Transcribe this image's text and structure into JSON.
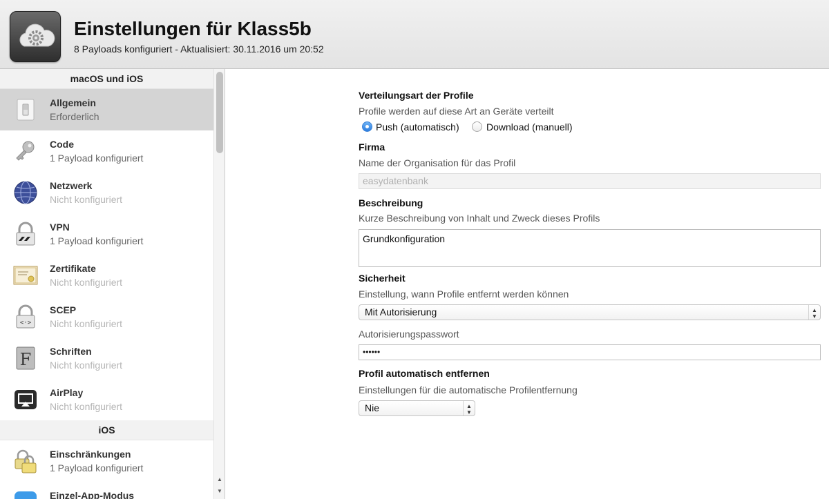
{
  "header": {
    "title": "Einstellungen für Klass5b",
    "subtitle": "8 Payloads konfiguriert - Aktualisiert: 30.11.2016 um 20:52",
    "icon": "cloud-gear-icon"
  },
  "sidebar": {
    "sections": [
      {
        "title": "macOS und iOS",
        "items": [
          {
            "title": "Allgemein",
            "subtitle": "Erforderlich",
            "icon": "switch-icon",
            "selected": true,
            "configured": true
          },
          {
            "title": "Code",
            "subtitle": "1 Payload konfiguriert",
            "icon": "key-icon",
            "configured": true
          },
          {
            "title": "Netzwerk",
            "subtitle": "Nicht konfiguriert",
            "icon": "globe-icon",
            "configured": false
          },
          {
            "title": "VPN",
            "subtitle": "1 Payload konfiguriert",
            "icon": "vpn-lock-icon",
            "configured": true
          },
          {
            "title": "Zertifikate",
            "subtitle": "Nicht konfiguriert",
            "icon": "certificate-icon",
            "configured": false
          },
          {
            "title": "SCEP",
            "subtitle": "Nicht konfiguriert",
            "icon": "scep-lock-icon",
            "configured": false
          },
          {
            "title": "Schriften",
            "subtitle": "Nicht konfiguriert",
            "icon": "font-icon",
            "configured": false
          },
          {
            "title": "AirPlay",
            "subtitle": "Nicht konfiguriert",
            "icon": "airplay-icon",
            "configured": false
          }
        ]
      },
      {
        "title": "iOS",
        "items": [
          {
            "title": "Einschränkungen",
            "subtitle": "1 Payload konfiguriert",
            "icon": "restrictions-lock-icon",
            "configured": true
          },
          {
            "title": "Einzel-App-Modus",
            "subtitle": "",
            "icon": "app-store-icon",
            "configured": false
          }
        ]
      }
    ]
  },
  "form": {
    "distribution": {
      "label": "Verteilungsart der Profile",
      "description": "Profile werden auf diese Art an Geräte verteilt",
      "options": [
        {
          "label": "Push (automatisch)",
          "selected": true
        },
        {
          "label": "Download (manuell)",
          "selected": false
        }
      ]
    },
    "company": {
      "label": "Firma",
      "description": "Name der Organisation für das Profil",
      "placeholder": "easydatenbank"
    },
    "description_field": {
      "label": "Beschreibung",
      "description": "Kurze Beschreibung von Inhalt und Zweck dieses Profils",
      "value": "Grundkonfiguration"
    },
    "security": {
      "label": "Sicherheit",
      "description": "Einstellung, wann Profile entfernt werden können",
      "selected": "Mit Autorisierung",
      "password_label": "Autorisierungspasswort",
      "password_value": "••••••"
    },
    "auto_remove": {
      "label": "Profil automatisch entfernen",
      "description": "Einstellungen für die automatische Profilentfernung",
      "selected": "Nie"
    }
  },
  "colors": {
    "selection": "#d4d4d4",
    "radio_accent": "#2c7de0",
    "muted_text": "#b5b5b5"
  }
}
